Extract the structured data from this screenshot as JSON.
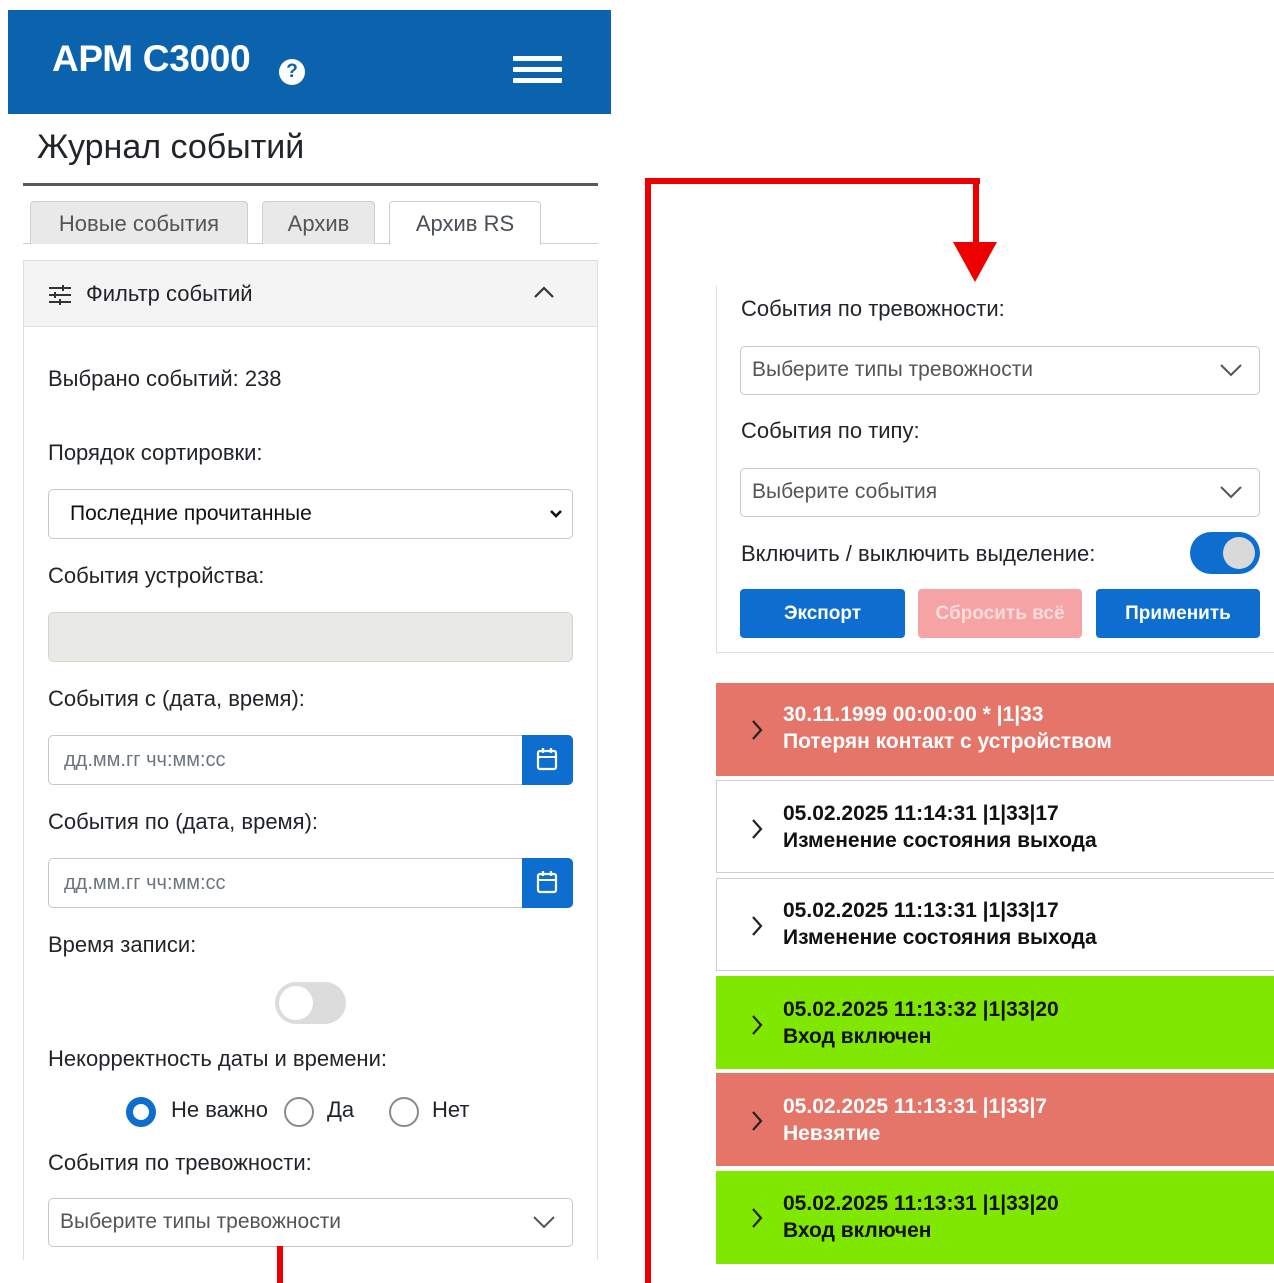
{
  "app": {
    "title": "АРМ С3000",
    "help_icon": "question-circle-icon",
    "menu_icon": "hamburger-menu-icon"
  },
  "page": {
    "title": "Журнал событий"
  },
  "tabs": [
    {
      "label": "Новые события",
      "active": false
    },
    {
      "label": "Архив",
      "active": false
    },
    {
      "label": "Архив RS",
      "active": true
    }
  ],
  "filter": {
    "header": "Фильтр событий",
    "selected_count_text": "Выбрано событий: 238",
    "sort_label": "Порядок сортировки:",
    "sort_value": "Последние прочитанные",
    "device_events_label": "События устройства:",
    "device_events_value": "",
    "from_label": "События с (дата, время):",
    "from_placeholder": "дд.мм.гг чч:мм:сс",
    "to_label": "События по (дата, время):",
    "to_placeholder": "дд.мм.гг чч:мм:сс",
    "record_time_label": "Время записи:",
    "record_time_enabled": false,
    "invalid_dt_label": "Некорректность даты и времени:",
    "invalid_dt_options": [
      "Не важно",
      "Да",
      "Нет"
    ],
    "invalid_dt_selected": "Не важно",
    "alarm_label": "События по тревожности:",
    "alarm_placeholder": "Выберите типы тревожности",
    "type_label": "События по типу:",
    "type_placeholder": "Выберите события",
    "highlight_label": "Включить / выключить выделение:",
    "highlight_enabled": true
  },
  "buttons": {
    "export": "Экспорт",
    "reset": "Сбросить всё",
    "apply": "Применить"
  },
  "events": [
    {
      "line1": "30.11.1999 00:00:00 *  |1|33",
      "line2": "Потерян контакт с устройством",
      "color": "#e57569"
    },
    {
      "line1": "05.02.2025 11:14:31  |1|33|17",
      "line2": "Изменение состояния выхода",
      "color": "#ffffff"
    },
    {
      "line1": "05.02.2025 11:13:31  |1|33|17",
      "line2": "Изменение состояния выхода",
      "color": "#ffffff"
    },
    {
      "line1": "05.02.2025 11:13:32  |1|33|20",
      "line2": "Вход включен",
      "color": "#80e800"
    },
    {
      "line1": "05.02.2025 11:13:31  |1|33|7",
      "line2": "Невзятие",
      "color": "#e57569"
    },
    {
      "line1": "05.02.2025 11:13:31  |1|33|20",
      "line2": "Вход включен",
      "color": "#80e800"
    }
  ],
  "colors": {
    "header_blue": "#0b63ad",
    "primary": "#0d6ecf",
    "alarm_red": "#e57569",
    "ok_green": "#80e800",
    "connector_red": "#ee0000"
  }
}
